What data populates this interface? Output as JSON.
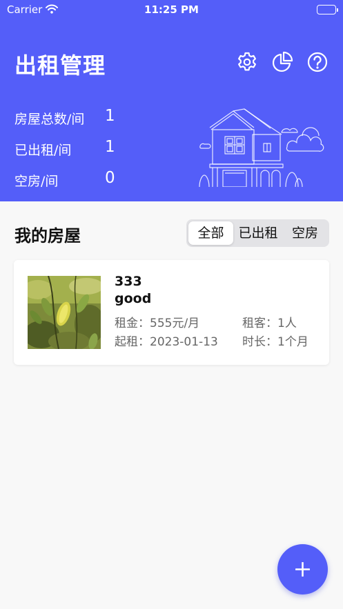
{
  "status_bar": {
    "carrier": "Carrier",
    "time": "11:25 PM"
  },
  "header": {
    "title": "出租管理",
    "icons": [
      "gear-icon",
      "pie-chart-icon",
      "help-icon"
    ],
    "stats": [
      {
        "label": "房屋总数/间",
        "value": "1"
      },
      {
        "label": "已出租/间",
        "value": "1"
      },
      {
        "label": "空房/间",
        "value": "0"
      }
    ]
  },
  "section": {
    "title": "我的房屋",
    "tabs": [
      {
        "label": "全部",
        "active": true
      },
      {
        "label": "已出租",
        "active": false
      },
      {
        "label": "空房",
        "active": false
      }
    ]
  },
  "houses": [
    {
      "name": "333",
      "description": "good",
      "rent_label": "租金：",
      "rent": "555元/月",
      "tenants_label": "租客：",
      "tenants": "1人",
      "start_label": "起租：",
      "start": "2023-01-13",
      "duration_label": "时长：",
      "duration": "1个月"
    }
  ],
  "fab": {
    "icon": "plus-icon"
  },
  "colors": {
    "primary": "#545ef9",
    "background": "#f8f8f8"
  }
}
